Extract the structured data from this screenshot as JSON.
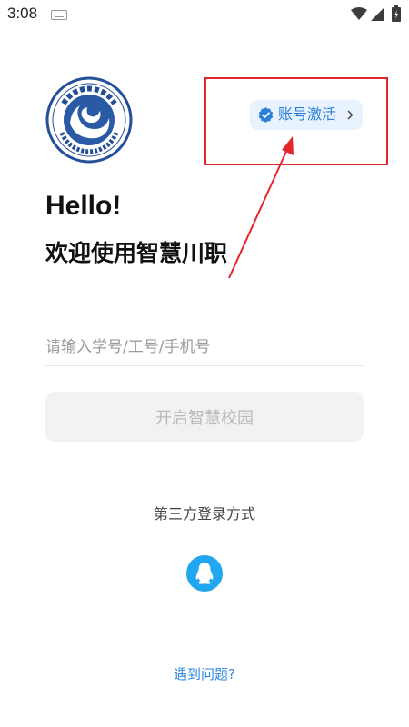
{
  "status_bar": {
    "time": "3:08",
    "icons": [
      "keyboard-icon",
      "wifi-icon",
      "signal-icon",
      "battery-icon"
    ]
  },
  "logo": {
    "name": "college-logo",
    "seal_text": "四川职业技术学院 Sichuan Vocational and Technical College"
  },
  "activate": {
    "label": "账号激活",
    "icon": "verified-badge-icon",
    "chevron": "chevron-right-icon"
  },
  "annotation": {
    "color": "#e3262b"
  },
  "heading": {
    "hello": "Hello!",
    "welcome": "欢迎使用智慧川职"
  },
  "login": {
    "input_placeholder": "请输入学号/工号/手机号",
    "input_value": "",
    "button_label": "开启智慧校园"
  },
  "third_party": {
    "title": "第三方登录方式",
    "options": [
      "qq-icon"
    ]
  },
  "help": {
    "link_label": "遇到问题?"
  },
  "colors": {
    "accent": "#2b7fd8",
    "chip_bg": "#e9f3ff",
    "qq": "#20a7f0",
    "button_disabled_bg": "#f2f2f2",
    "button_disabled_text": "#b9b9b9"
  }
}
